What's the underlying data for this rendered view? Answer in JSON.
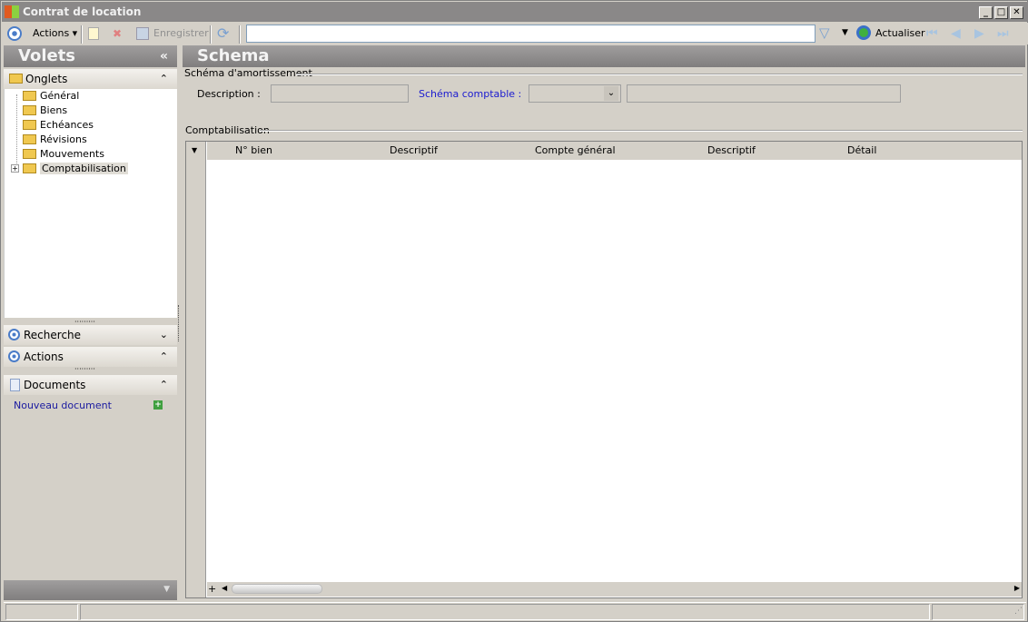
{
  "window": {
    "title": "Contrat de location"
  },
  "toolbar": {
    "actions": "Actions",
    "save": "Enregistrer",
    "search_value": "",
    "refresh": "Actualiser"
  },
  "left": {
    "title": "Volets",
    "onglets": "Onglets",
    "tree": [
      "Général",
      "Biens",
      "Echéances",
      "Révisions",
      "Mouvements",
      "Comptabilisation"
    ],
    "recherche": "Recherche",
    "actions": "Actions",
    "documents": "Documents",
    "new_doc": "Nouveau document"
  },
  "main": {
    "title": "Schema",
    "group1": "Schéma d'amortissement",
    "description_label": "Description :",
    "description_value": "",
    "schema_label": "Schéma comptable :",
    "schema_value": "",
    "schema_desc": "",
    "group2": "Comptabilisation",
    "columns": [
      "N° bien",
      "Descriptif",
      "Compte général",
      "Descriptif",
      "Détail"
    ]
  }
}
